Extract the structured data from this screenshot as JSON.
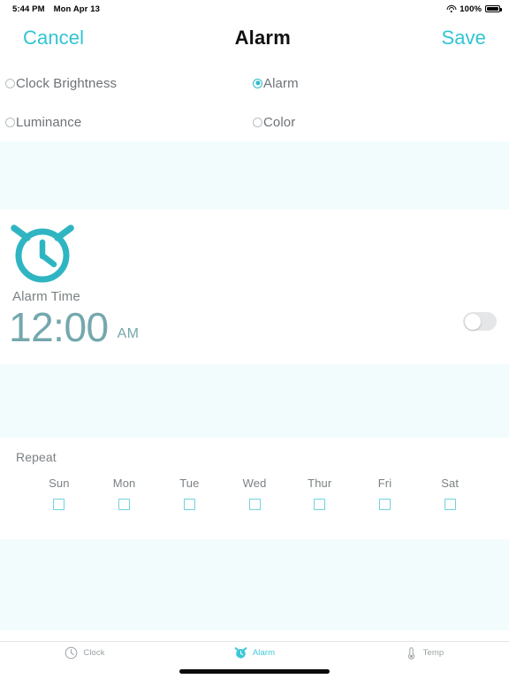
{
  "status_bar": {
    "time": "5:44 PM",
    "date": "Mon Apr 13",
    "wifi_icon": "wifi-icon",
    "battery_percent": "100%",
    "battery_icon": "battery-full-icon"
  },
  "nav": {
    "cancel_label": "Cancel",
    "title": "Alarm",
    "save_label": "Save"
  },
  "settings_radios": [
    {
      "label": "Clock Brightness",
      "selected": false
    },
    {
      "label": "Alarm",
      "selected": true
    },
    {
      "label": "Luminance",
      "selected": false
    },
    {
      "label": "Color",
      "selected": false
    }
  ],
  "alarm": {
    "icon": "alarm-clock-icon",
    "time_label": "Alarm Time",
    "time_value": "12:00",
    "meridiem": "AM",
    "enabled": false
  },
  "repeat": {
    "label": "Repeat",
    "days": [
      {
        "name": "Sun",
        "checked": false
      },
      {
        "name": "Mon",
        "checked": false
      },
      {
        "name": "Tue",
        "checked": false
      },
      {
        "name": "Wed",
        "checked": false
      },
      {
        "name": "Thur",
        "checked": false
      },
      {
        "name": "Fri",
        "checked": false
      },
      {
        "name": "Sat",
        "checked": false
      }
    ]
  },
  "tabs": [
    {
      "label": "Clock",
      "icon": "clock-icon",
      "active": false
    },
    {
      "label": "Alarm",
      "icon": "alarm-clock-icon",
      "active": true
    },
    {
      "label": "Temp",
      "icon": "thermometer-icon",
      "active": false
    }
  ],
  "colors": {
    "accent": "#30c5d2",
    "accent_dark": "#2fbcc9",
    "time_text": "#74a8ad",
    "label_gray": "#7b8184",
    "band_tint": "#f3fcfd",
    "checkbox_border": "#6fd2de"
  }
}
